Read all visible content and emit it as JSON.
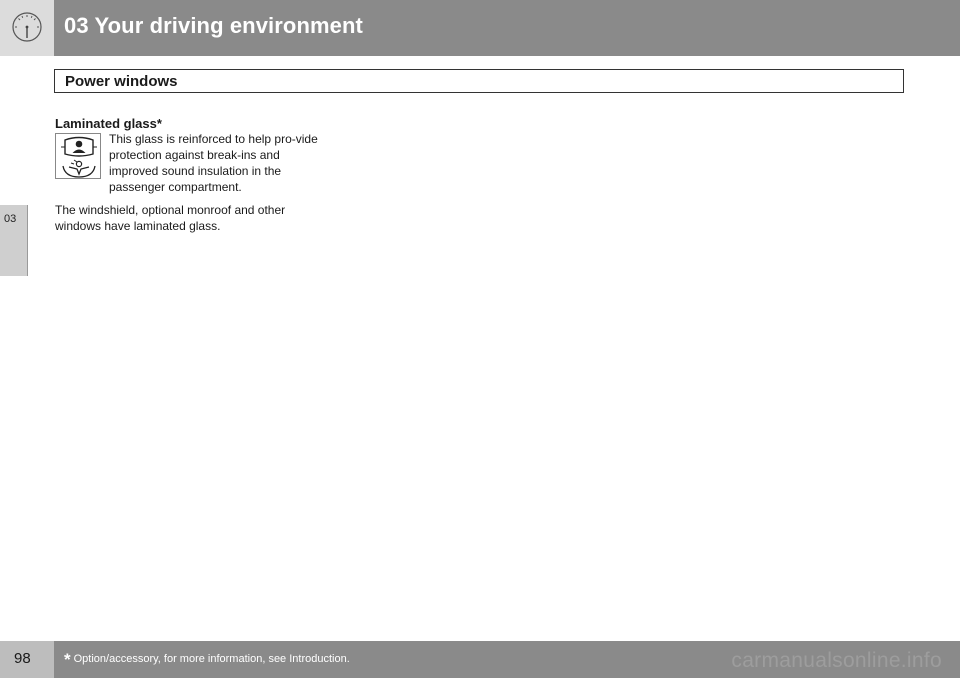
{
  "header": {
    "chapter_title": "03 Your driving environment",
    "icon": "speedometer-icon"
  },
  "side_tab": {
    "label": "03"
  },
  "section": {
    "title": "Power windows"
  },
  "content": {
    "subheading": "Laminated glass*",
    "symbol_icon": "laminated-glass-icon",
    "paragraph_1": "This glass is reinforced to help pro-vide protection against break-ins and improved sound insulation in the passenger compartment.",
    "paragraph_2": "The windshield, optional monroof and other windows have laminated glass."
  },
  "footer": {
    "page_number": "98",
    "footnote_marker": "*",
    "footnote_text": "Option/accessory, for more information, see Introduction.",
    "watermark": "carmanualsonline.info"
  },
  "colors": {
    "header_bar": "#8a8a8a",
    "header_icon_box": "#dcdcdc",
    "side_tab": "#cfcfcf",
    "footer_bar": "#8a8a8a",
    "page_num_box": "#bdbdbd"
  }
}
